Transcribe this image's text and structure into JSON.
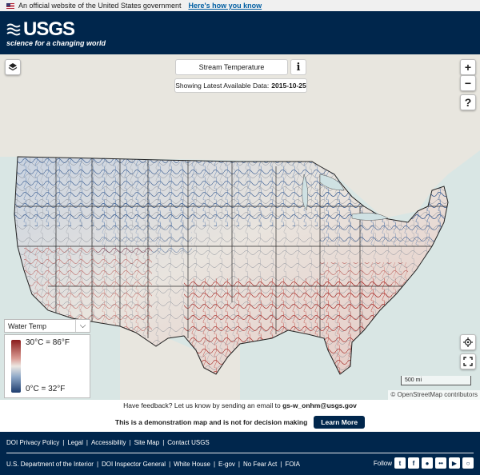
{
  "gov_banner": {
    "text": "An official website of the United States government",
    "link": "Here's how you know"
  },
  "header": {
    "logo_text": "USGS",
    "tagline": "science for a changing world"
  },
  "map": {
    "title": "Stream Temperature",
    "info_icon": "i",
    "date_label": "Showing Latest Available Data:",
    "date_value": "2015-10-25",
    "controls": {
      "layers_icon": "layers-icon",
      "zoom_in": "+",
      "zoom_out": "−",
      "help": "?"
    },
    "legend": {
      "select_value": "Water Temp",
      "high_label": "30°C = 86°F",
      "low_label": "0°C = 32°F"
    },
    "scale_label": "500 mi",
    "attribution": "© OpenStreetMap contributors",
    "colors": {
      "warm": "#8b1c1c",
      "cold": "#1d3c6e",
      "land": "#ece7e2",
      "water": "#d9e6e4"
    }
  },
  "feedback": {
    "text": "Have feedback? Let us know by sending an email to",
    "email": "gs-w_onhm@usgs.gov"
  },
  "demo": {
    "text": "This is a demonstration map and is not for decision making",
    "button": "Learn More"
  },
  "footer": {
    "links_row1": [
      "DOI Privacy Policy",
      "Legal",
      "Accessibility",
      "Site Map",
      "Contact USGS"
    ],
    "links_row2": [
      "U.S. Department of the Interior",
      "DOI Inspector General",
      "White House",
      "E-gov",
      "No Fear Act",
      "FOIA"
    ],
    "follow_label": "Follow",
    "social_icons": [
      "twitter-icon",
      "facebook-icon",
      "github-icon",
      "flickr-icon",
      "youtube-icon",
      "instagram-icon"
    ]
  }
}
